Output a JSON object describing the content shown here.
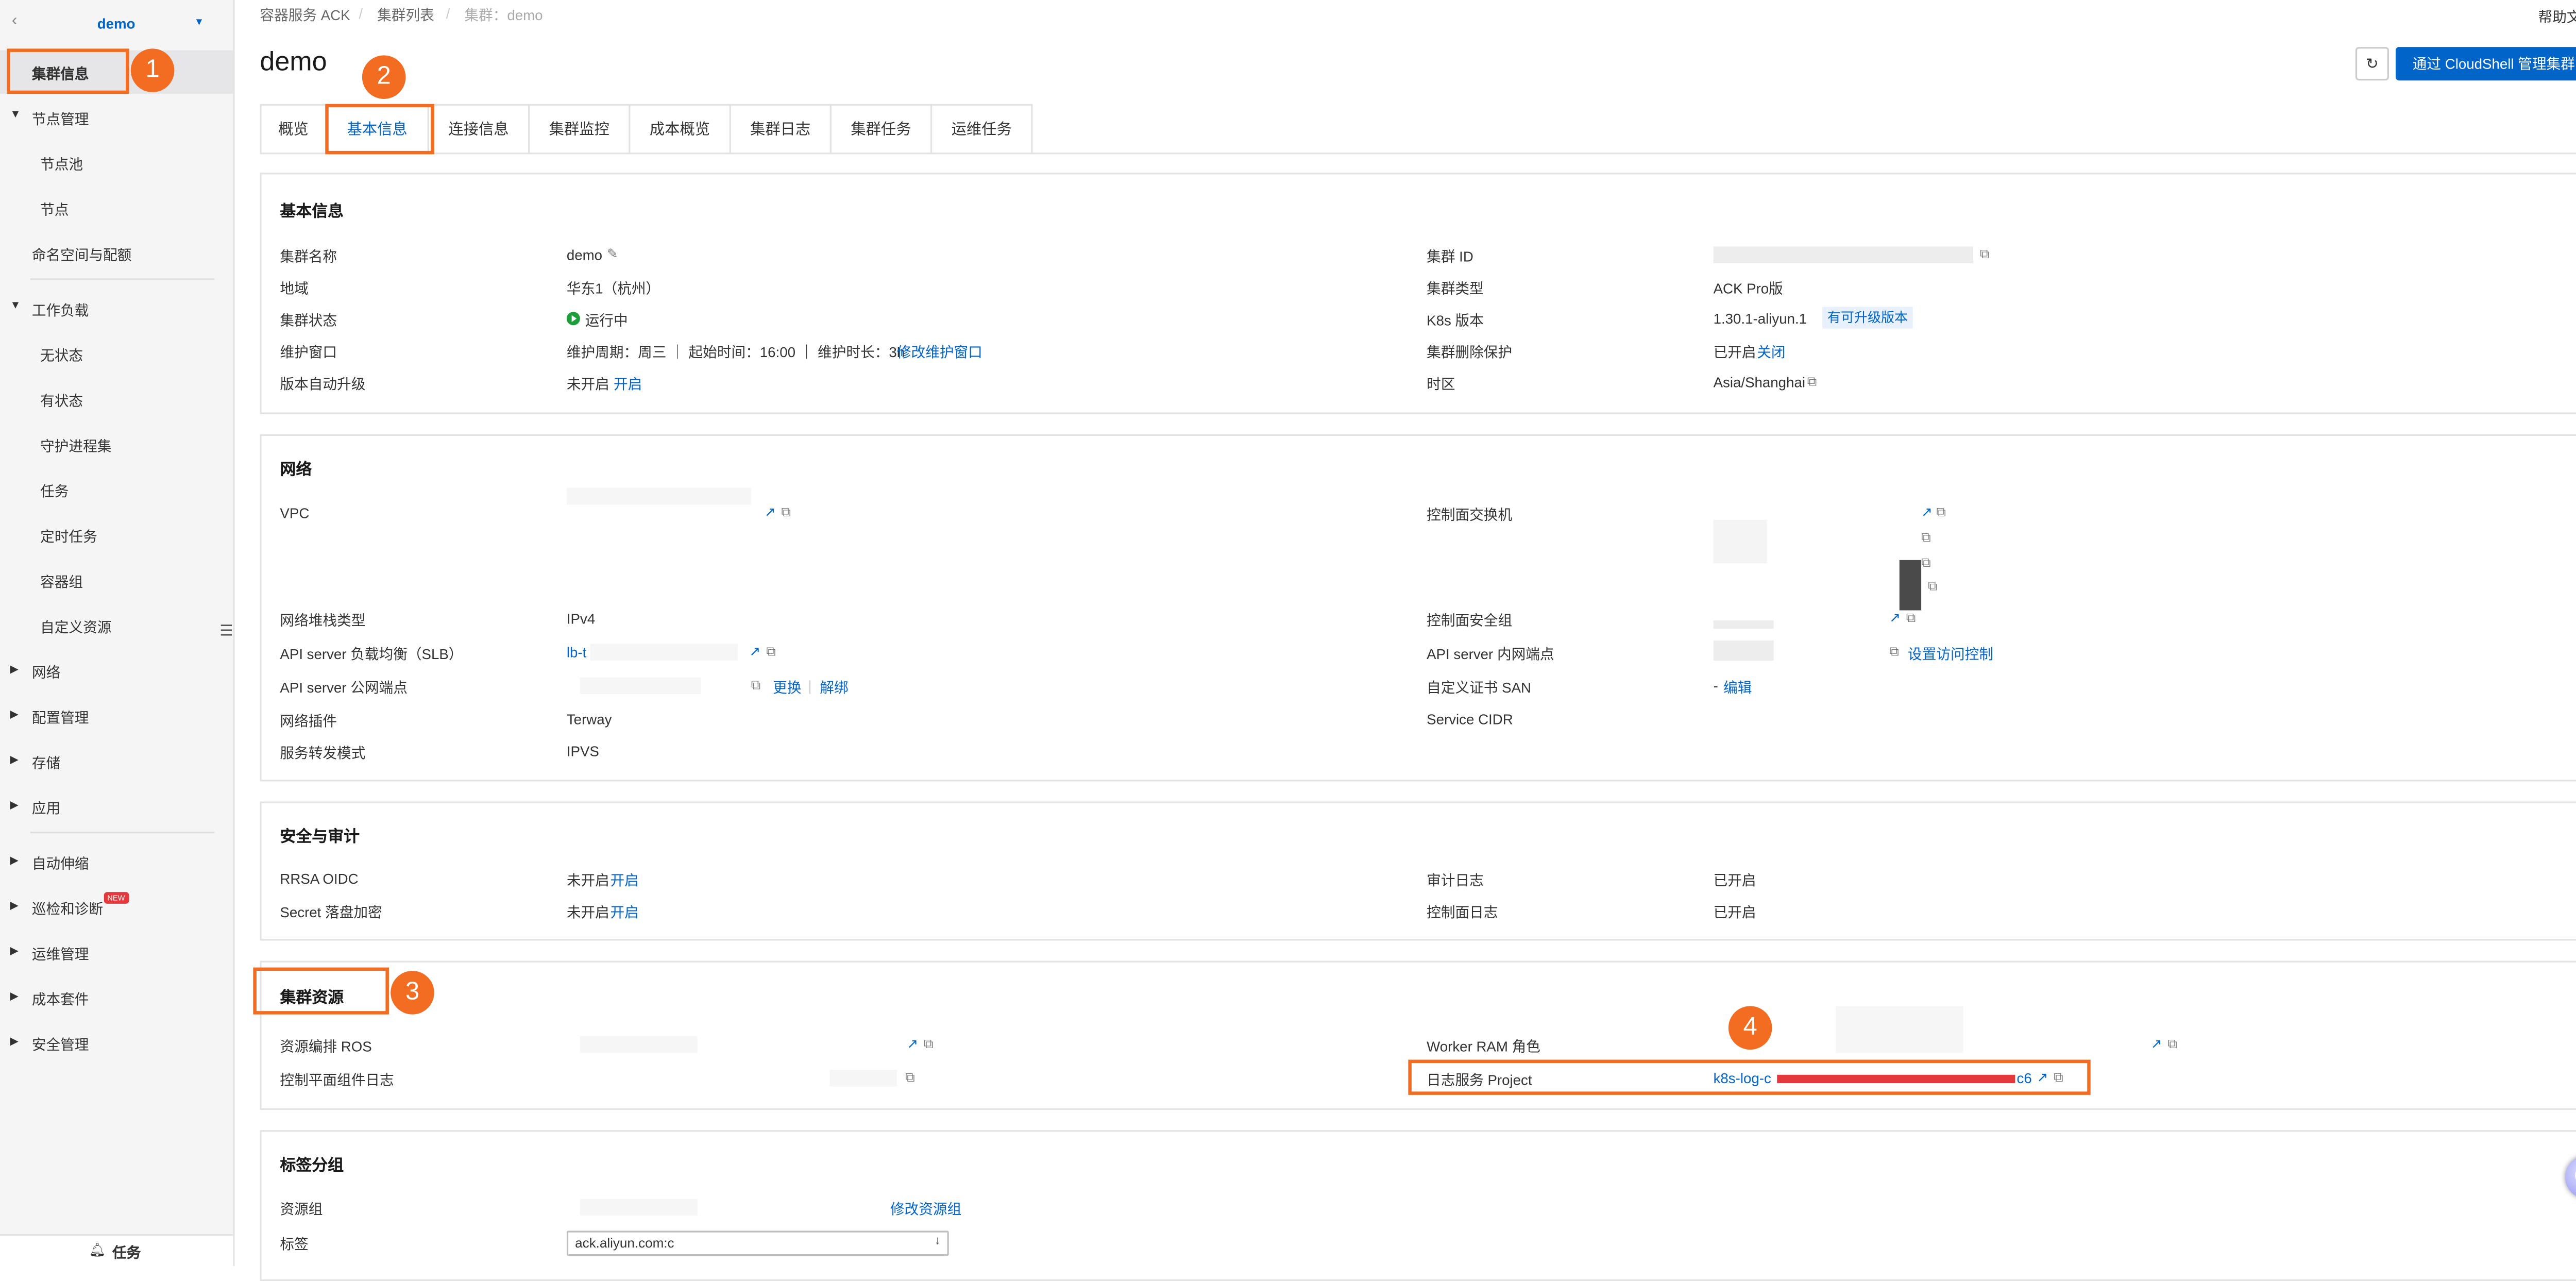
{
  "sidebar": {
    "cluster_name": "demo",
    "items": [
      {
        "label": "集群信息"
      },
      {
        "label": "节点管理"
      },
      {
        "label": "节点池"
      },
      {
        "label": "节点"
      },
      {
        "label": "命名空间与配额"
      },
      {
        "label": "工作负载"
      },
      {
        "label": "无状态"
      },
      {
        "label": "有状态"
      },
      {
        "label": "守护进程集"
      },
      {
        "label": "任务"
      },
      {
        "label": "定时任务"
      },
      {
        "label": "容器组"
      },
      {
        "label": "自定义资源"
      },
      {
        "label": "网络"
      },
      {
        "label": "配置管理"
      },
      {
        "label": "存储"
      },
      {
        "label": "应用"
      },
      {
        "label": "自动伸缩"
      },
      {
        "label": "巡检和诊断"
      },
      {
        "label": "运维管理"
      },
      {
        "label": "成本套件"
      },
      {
        "label": "安全管理"
      }
    ],
    "new_badge": "NEW",
    "bottom_label": "任务"
  },
  "breadcrumb": [
    "容器服务 ACK",
    "集群列表",
    "集群：demo"
  ],
  "help_label": "帮助文档",
  "page_title": "demo",
  "cloudshell_button": "通过 CloudShell 管理集群",
  "tabs": [
    "概览",
    "基本信息",
    "连接信息",
    "集群监控",
    "成本概览",
    "集群日志",
    "集群任务",
    "运维任务"
  ],
  "annotations": [
    "1",
    "2",
    "3",
    "4"
  ],
  "basic": {
    "title": "基本信息",
    "cluster_name_label": "集群名称",
    "cluster_name": "demo",
    "region_label": "地域",
    "region": "华东1（杭州）",
    "status_label": "集群状态",
    "status": "运行中",
    "maint_label": "维护窗口",
    "maint": "维护周期：周三 ｜ 起始时间：16:00 ｜ 维护时长：3h",
    "maint_link": "修改维护窗口",
    "autoupgrade_label": "版本自动升级",
    "autoupgrade": "未开启",
    "autoupgrade_link": "开启",
    "cluster_id_label": "集群 ID",
    "cluster_type_label": "集群类型",
    "cluster_type": "ACK Pro版",
    "k8s_label": "K8s 版本",
    "k8s": "1.30.1-aliyun.1",
    "k8s_badge": "有可升级版本",
    "delprot_label": "集群删除保护",
    "delprot": "已开启",
    "delprot_link": "关闭",
    "tz_label": "时区",
    "tz": "Asia/Shanghai"
  },
  "network": {
    "title": "网络",
    "vpc_label": "VPC",
    "stack_label": "网络堆栈类型",
    "stack": "IPv4",
    "slb_label": "API server 负载均衡（SLB）",
    "slb": "lb-t",
    "public_label": "API server 公网端点",
    "public_change": "更换",
    "public_unbind": "解绑",
    "plugin_label": "网络插件",
    "plugin": "Terway",
    "fwd_label": "服务转发模式",
    "fwd": "IPVS",
    "vswitch_label": "控制面交换机",
    "sg_label": "控制面安全组",
    "internal_label": "API server 内网端点",
    "internal_link": "设置访问控制",
    "san_label": "自定义证书 SAN",
    "san_value": "-",
    "san_link": "编辑",
    "cidr_label": "Service CIDR"
  },
  "security": {
    "title": "安全与审计",
    "rrsa_label": "RRSA OIDC",
    "rrsa": "未开启",
    "rrsa_link": "开启",
    "secret_label": "Secret 落盘加密",
    "secret": "未开启",
    "secret_link": "开启",
    "audit_label": "审计日志",
    "audit": "已开启",
    "cplog_label": "控制面日志",
    "cplog": "已开启"
  },
  "resources": {
    "title": "集群资源",
    "ros_label": "资源编排 ROS",
    "cplog_label": "控制平面组件日志",
    "worker_label": "Worker RAM 角色",
    "sls_label": "日志服务 Project",
    "sls_prefix": "k8s-log-c",
    "sls_suffix": "c6"
  },
  "tags": {
    "title": "标签分组",
    "rg_label": "资源组",
    "rg_link": "修改资源组",
    "tag_label": "标签",
    "tag_value": "ack.aliyun.com:c"
  }
}
